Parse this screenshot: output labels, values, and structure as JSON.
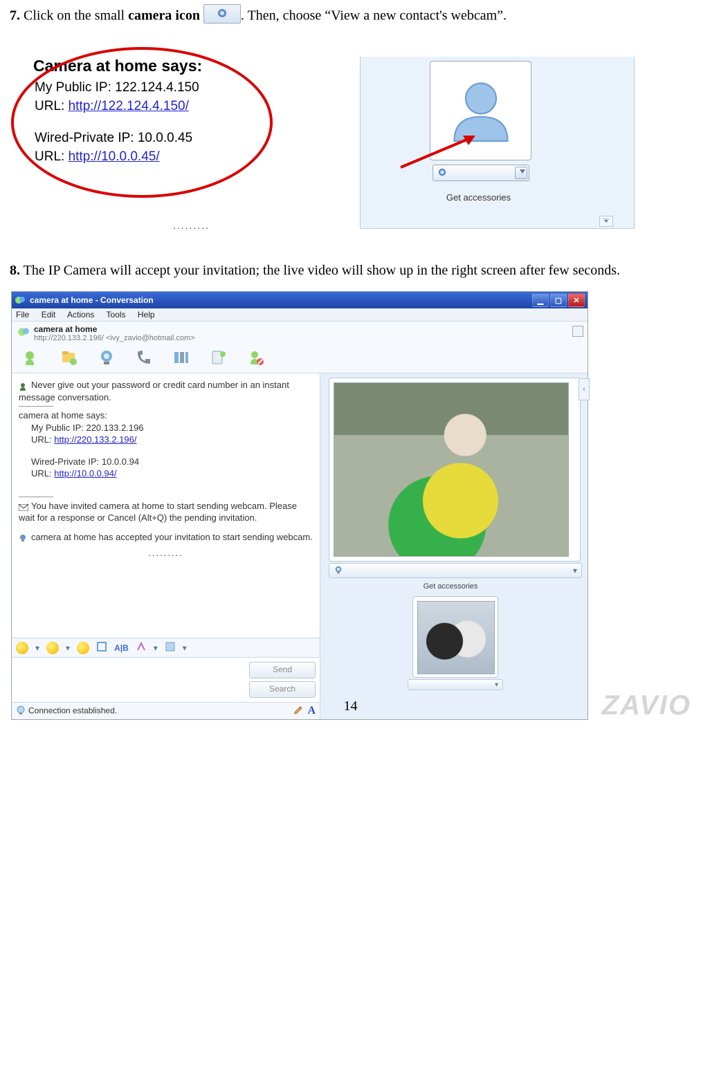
{
  "step7": {
    "num": "7.",
    "pre": " Click on the small ",
    "bold": "camera icon",
    "post": ". Then, choose “View a new contact's webcam”."
  },
  "fig1": {
    "title": "Camera at home says:",
    "line1": "My Public IP: 122.124.4.150",
    "line2_label": "URL: ",
    "line2_link": "http://122.124.4.150/",
    "line3": "Wired-Private IP: 10.0.0.45",
    "line4_label": "URL: ",
    "line4_link": "http://10.0.0.45/",
    "dots": ".........",
    "get_accessories": "Get accessories"
  },
  "step8": {
    "num": "8.",
    "text": " The IP Camera will accept your invitation; the live video will show up in the right screen after few seconds."
  },
  "win": {
    "title": "camera at home - Conversation",
    "menu": [
      "File",
      "Edit",
      "Actions",
      "Tools",
      "Help"
    ],
    "contact_name": "camera at home",
    "contact_sub": "http://220.133.2.196/ <ivy_zavio@hotmail.com>",
    "warn": "Never give out your password or credit card number in an instant message conversation.",
    "says": "camera at home says:",
    "pub_ip": "My Public IP: 220.133.2.196",
    "pub_url_label": "URL: ",
    "pub_url": "http://220.133.2.196/",
    "priv_ip": "Wired-Private IP: 10.0.0.94",
    "priv_url_label": "URL: ",
    "priv_url": "http://10.0.0.94/",
    "invite": "You have invited camera at home to start sending webcam. Please wait for a response or Cancel (Alt+Q) the pending invitation.",
    "accepted": "camera at home has accepted your invitation to start sending webcam.",
    "dots": ".........",
    "emobar_ab": "A|B",
    "send": "Send",
    "search": "Search",
    "status": "Connection established.",
    "get_acc": "Get accessories"
  },
  "page_number": "14",
  "watermark": "ZAVIO"
}
